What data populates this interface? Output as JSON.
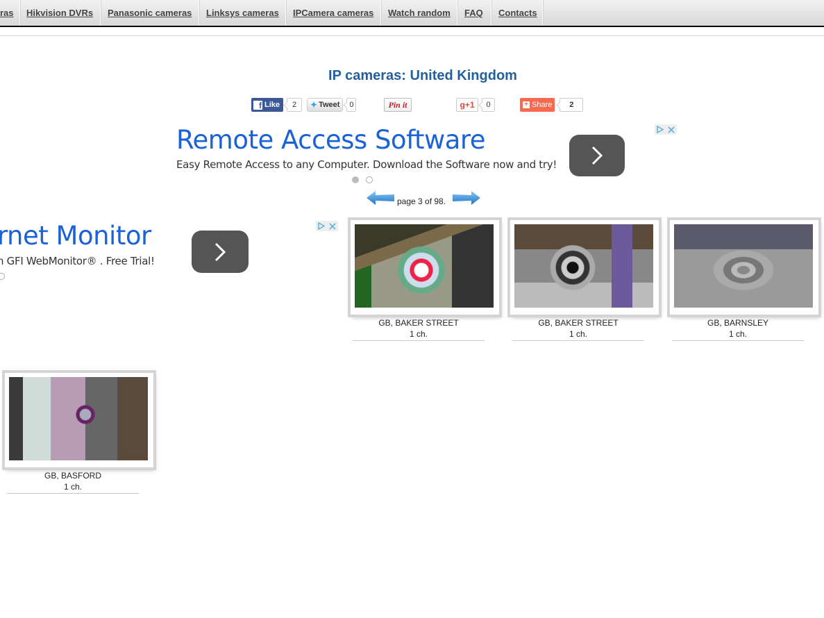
{
  "nav": {
    "items": [
      {
        "label": "ras"
      },
      {
        "label": "Hikvision DVRs"
      },
      {
        "label": "Panasonic cameras"
      },
      {
        "label": "Linksys cameras"
      },
      {
        "label": "IPCamera cameras"
      },
      {
        "label": "Watch random"
      },
      {
        "label": "FAQ"
      },
      {
        "label": "Contacts"
      }
    ]
  },
  "page": {
    "title": "IP cameras: United Kingdom"
  },
  "social": {
    "facebook": {
      "label": "Like",
      "count": "2"
    },
    "twitter": {
      "label": "Tweet",
      "count": "0"
    },
    "pinterest": {
      "label": "Pin it"
    },
    "googleplus": {
      "label": "+1",
      "count": "0"
    },
    "share": {
      "label": "Share",
      "count": "2"
    }
  },
  "ads": [
    {
      "headline": "Remote Access Software",
      "description": "Easy Remote Access to any Computer. Download the Software now and try!",
      "go_icon": "chevron-right-icon",
      "choices_icons": [
        "adchoices-icon",
        "close-icon"
      ]
    },
    {
      "headline": "rnet Monitor",
      "description": "n GFI WebMonitor® . Free Trial!",
      "go_icon": "chevron-right-icon",
      "choices_icons": [
        "adchoices-icon",
        "close-icon"
      ]
    }
  ],
  "pager": {
    "text": "page 3 of 98.",
    "current": 3,
    "total": 98,
    "prev_icon": "arrow-left-icon",
    "next_icon": "arrow-right-icon"
  },
  "cameras": [
    {
      "location": "GB, BAKER STREET",
      "channels": "1 ch."
    },
    {
      "location": "GB, BAKER STREET",
      "channels": "1 ch."
    },
    {
      "location": "GB, BARNSLEY",
      "channels": "1 ch."
    },
    {
      "location": "GB, BASFORD",
      "channels": "1 ch."
    }
  ],
  "colors": {
    "title": "#24609c",
    "ad_headline": "#1a62d6",
    "facebook": "#3b5998",
    "share": "#f8694d",
    "pinterest": "#bd2126",
    "googleplus": "#dd4b39"
  }
}
